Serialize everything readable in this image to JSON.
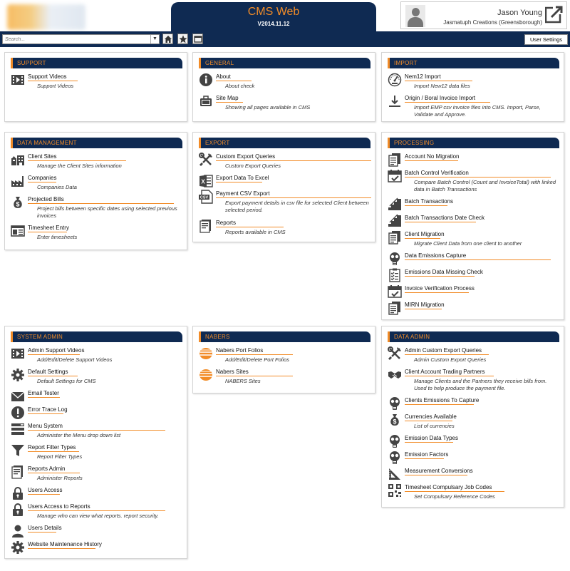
{
  "app": {
    "title": "CMS Web",
    "version": "V2014.11.12"
  },
  "user": {
    "name": "Jason Young",
    "org": "Jasmatuph Creations (Greensborough)"
  },
  "toolbar": {
    "search_placeholder": "Search...",
    "user_settings_label": "User Settings"
  },
  "colors": {
    "navy": "#0f2a52",
    "orange": "#f28c28",
    "icon": "#444444"
  },
  "sections": {
    "support": {
      "title": "Support",
      "items": [
        {
          "title": "Support Videos",
          "desc": "Support Videos",
          "icon": "video-icon"
        }
      ]
    },
    "general": {
      "title": "General",
      "items": [
        {
          "title": "About",
          "desc": "About check",
          "icon": "info-icon"
        },
        {
          "title": "Site Map",
          "desc": "Showing all pages available in CMS",
          "icon": "briefcase-icon"
        }
      ]
    },
    "import": {
      "title": "Import",
      "items": [
        {
          "title": "Nem12 Import",
          "desc": "Import New12 data files",
          "icon": "gauge-icon"
        },
        {
          "title": "Origin / Boral Invoice Import",
          "desc": "Import EMP csv invoice files into CMS. Import, Parse, Validate and Approve.",
          "icon": "download-icon"
        }
      ]
    },
    "data_management": {
      "title": "Data Management",
      "items": [
        {
          "title": "Client Sites",
          "desc": "Manage the Client Sites information",
          "icon": "buildings-icon"
        },
        {
          "title": "Companies",
          "desc": "Companies Data",
          "icon": "factory-icon"
        },
        {
          "title": "Projected Bills",
          "desc": "Project bills between specific dates using selected previous invoices",
          "icon": "money-bag-icon"
        },
        {
          "title": "Timesheet Entry",
          "desc": "Enter timesheets",
          "icon": "timesheet-icon"
        }
      ]
    },
    "export": {
      "title": "Export",
      "items": [
        {
          "title": "Custom Export Queries",
          "desc": "Custom Export Queries",
          "icon": "tools-icon"
        },
        {
          "title": "Export Data To Excel",
          "desc": "",
          "icon": "excel-icon"
        },
        {
          "title": "Payment CSV Export",
          "desc": "Export payment details in csv file for selected Client between selected period.",
          "icon": "csv-icon"
        },
        {
          "title": "Reports",
          "desc": "Reports available in CMS",
          "icon": "report-book-icon"
        }
      ]
    },
    "processing": {
      "title": "Processing",
      "items": [
        {
          "title": "Account No Migration",
          "desc": "",
          "icon": "documents-icon"
        },
        {
          "title": "Batch Control Verification",
          "desc": "Compare Batch Control (Count and InvoiceTotal) with linked data in Batch Transactions",
          "icon": "calendar-icon"
        },
        {
          "title": "Batch Transactions",
          "desc": "",
          "icon": "stairs-icon"
        },
        {
          "title": "Batch Transactions Date Check",
          "desc": "",
          "icon": "stairs-icon"
        },
        {
          "title": "Client Migration",
          "desc": "Migrate Client Data from one client to another",
          "icon": "documents-icon"
        },
        {
          "title": "Data Emissions Capture",
          "desc": "",
          "icon": "gas-mask-icon"
        },
        {
          "title": "Emissions Data Missing Check",
          "desc": "",
          "icon": "checklist-icon"
        },
        {
          "title": "Invoice Verification Process",
          "desc": "",
          "icon": "calendar-icon"
        },
        {
          "title": "MIRN Migration",
          "desc": "",
          "icon": "documents-icon"
        }
      ]
    },
    "system_admin": {
      "title": "System Admin",
      "items": [
        {
          "title": "Admin Support Videos",
          "desc": "Add/Edit/Delete Support Videos",
          "icon": "video-icon"
        },
        {
          "title": "Default Settings",
          "desc": "Default Settings for CMS",
          "icon": "gear-icon"
        },
        {
          "title": "Email Tester",
          "desc": "",
          "icon": "envelope-icon"
        },
        {
          "title": "Error Trace Log",
          "desc": "",
          "icon": "error-icon"
        },
        {
          "title": "Menu System",
          "desc": "Administer the Menu drop down list",
          "icon": "menu-icon"
        },
        {
          "title": "Report Filter Types",
          "desc": "Report Filter Types",
          "icon": "filter-icon"
        },
        {
          "title": "Reports Admin",
          "desc": "Administer Reports",
          "icon": "report-book-icon"
        },
        {
          "title": "Users Access",
          "desc": "",
          "icon": "lock-icon"
        },
        {
          "title": "Users Access to Reports",
          "desc": "Manage who can view what reports. report security.",
          "icon": "lock-icon"
        },
        {
          "title": "Users Details",
          "desc": "",
          "icon": "user-icon"
        },
        {
          "title": "Website Maintenance History",
          "desc": "",
          "icon": "gear-icon"
        }
      ]
    },
    "nabers": {
      "title": "Nabers",
      "items": [
        {
          "title": "Nabers Port Folios",
          "desc": "Add/Edit/Delete Port Folios",
          "icon": "nabers-logo-icon"
        },
        {
          "title": "Nabers Sites",
          "desc": "NABERS Sites",
          "icon": "nabers-logo-icon"
        }
      ]
    },
    "data_admin": {
      "title": "Data Admin",
      "items": [
        {
          "title": "Admin Custom Export Queries",
          "desc": "Admin Custom Export Queries",
          "icon": "tools-icon"
        },
        {
          "title": "Client Account Trading Partners",
          "desc": "Manage Clients and the Partners they receive bills from. Used to help produce the payment file.",
          "icon": "handshake-icon"
        },
        {
          "title": "Clients Emissions To Capture",
          "desc": "",
          "icon": "gas-mask-icon"
        },
        {
          "title": "Currencies Available",
          "desc": "List of currencies",
          "icon": "money-bag-icon"
        },
        {
          "title": "Emission Data Types",
          "desc": "",
          "icon": "gas-mask-icon"
        },
        {
          "title": "Emission Factors",
          "desc": "",
          "icon": "gas-mask-icon"
        },
        {
          "title": "Measurement Conversions",
          "desc": "",
          "icon": "set-square-icon"
        },
        {
          "title": "Timesheet Compulsary Job Codes",
          "desc": "Set Compulsary Reference Codes",
          "icon": "qr-code-icon"
        }
      ]
    }
  }
}
